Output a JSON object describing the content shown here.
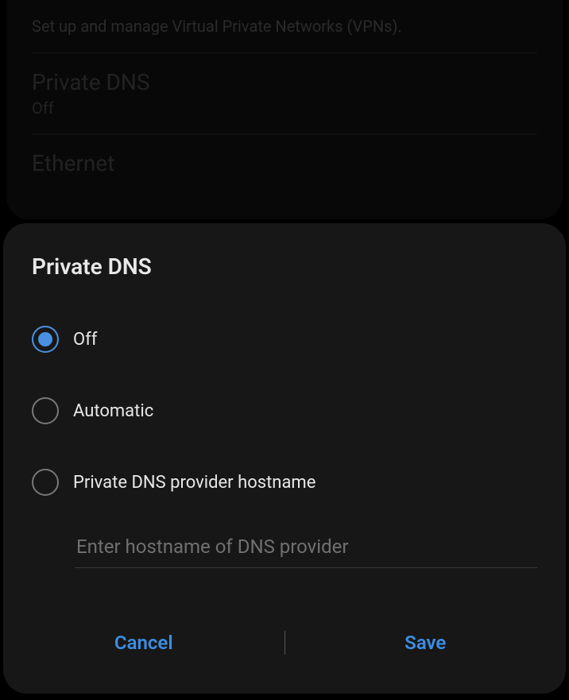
{
  "background": {
    "vpn_subtitle": "Set up and manage Virtual Private Networks (VPNs).",
    "private_dns_title": "Private DNS",
    "private_dns_status": "Off",
    "ethernet_title": "Ethernet"
  },
  "dialog": {
    "title": "Private DNS",
    "options": {
      "off": "Off",
      "automatic": "Automatic",
      "hostname": "Private DNS provider hostname"
    },
    "hostname_placeholder": "Enter hostname of DNS provider",
    "hostname_value": "",
    "selected": "off",
    "cancel_label": "Cancel",
    "save_label": "Save"
  },
  "colors": {
    "accent": "#3d8de0",
    "radio_selected": "#4a90e2"
  }
}
